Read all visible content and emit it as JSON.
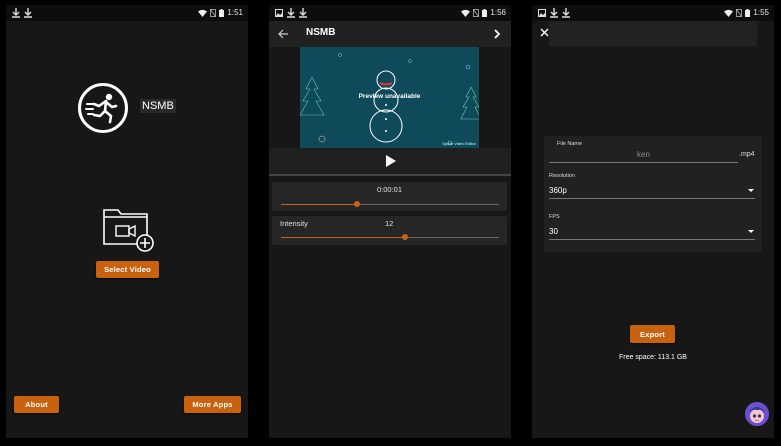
{
  "screens": [
    {
      "status": {
        "time": "1:51"
      },
      "app_name": "NSMB",
      "select_video_label": "Select Video",
      "about_label": "About",
      "more_apps_label": "More Apps"
    },
    {
      "status": {
        "time": "1:56"
      },
      "title": "NSMB",
      "preview_text": "Preview unavailable",
      "watermark": "Splice Video Editor",
      "time_value": "0:00:01",
      "time_progress": 0.35,
      "intensity_label": "Intensity",
      "intensity_value": "12",
      "intensity_progress": 0.57
    },
    {
      "status": {
        "time": "1:55"
      },
      "file_name_label": "File Name",
      "file_name_value": "ken",
      "file_ext": ".mp4",
      "resolution_label": "Resolution",
      "resolution_value": "360p",
      "fps_label": "FPS",
      "fps_value": "30",
      "export_label": "Export",
      "free_space": "Free space: 113.1 GB"
    }
  ],
  "colors": {
    "accent": "#c9620f",
    "background": "#171717",
    "video_bg": "#0f4a5a"
  },
  "icons": [
    "download-icon",
    "wifi-icon",
    "no-sim-icon",
    "battery-icon",
    "running-man-icon",
    "video-folder-icon",
    "back-arrow-icon",
    "chevron-right-icon",
    "play-icon",
    "close-icon",
    "dropdown-caret-icon",
    "avatar-icon"
  ]
}
